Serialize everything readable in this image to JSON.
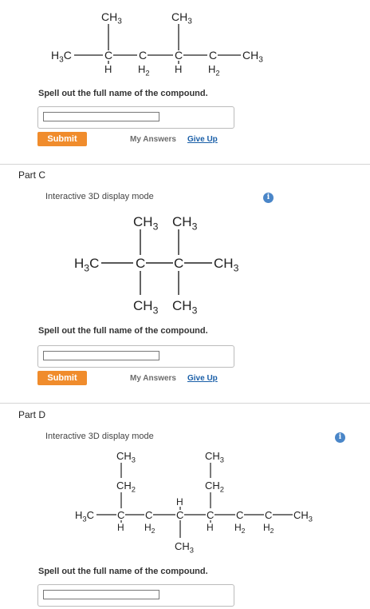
{
  "partB": {
    "structure_labels": {
      "ch3_a": "CH3",
      "ch3_b": "CH3",
      "h3c": "H3C",
      "c1": "C",
      "c2": "C",
      "c3": "C",
      "c4": "C",
      "ch3_end": "CH3",
      "h_1": "H",
      "h2_2": "H2",
      "h_3": "H",
      "h2_4": "H2"
    },
    "prompt": "Spell out the full name of the compound.",
    "input_value": "",
    "submit_label": "Submit",
    "my_answers_label": "My Answers",
    "give_up_label": "Give Up"
  },
  "partC": {
    "title": "Part C",
    "mode_label": "Interactive 3D display mode",
    "structure_labels": {
      "ch3_top1": "CH3",
      "ch3_top2": "CH3",
      "h3c": "H3C",
      "c1": "C",
      "c2": "C",
      "ch3_right": "CH3",
      "ch3_bot1": "CH3",
      "ch3_bot2": "CH3"
    },
    "prompt": "Spell out the full name of the compound.",
    "input_value": "",
    "submit_label": "Submit",
    "my_answers_label": "My Answers",
    "give_up_label": "Give Up"
  },
  "partD": {
    "title": "Part D",
    "mode_label": "Interactive 3D display mode",
    "structure_labels": {
      "ch3_top1": "CH3",
      "ch2_1": "CH2",
      "ch3_top2": "CH3",
      "ch2_2": "CH2",
      "h3c": "H3C",
      "c1": "C",
      "c2": "C",
      "c3": "C",
      "c4": "C",
      "c5": "C",
      "c6": "C",
      "ch3_end": "CH3",
      "h_1": "H",
      "h2_2": "H2",
      "h_up": "H",
      "h_4": "H",
      "h2_5": "H2",
      "h2_6": "H2",
      "ch3_bottom": "CH3"
    },
    "prompt": "Spell out the full name of the compound.",
    "input_value": ""
  },
  "info_icon_glyph": "i",
  "colors": {
    "submit": "#f08c2c",
    "link": "#1a5fa8",
    "info": "#4a86c8"
  }
}
